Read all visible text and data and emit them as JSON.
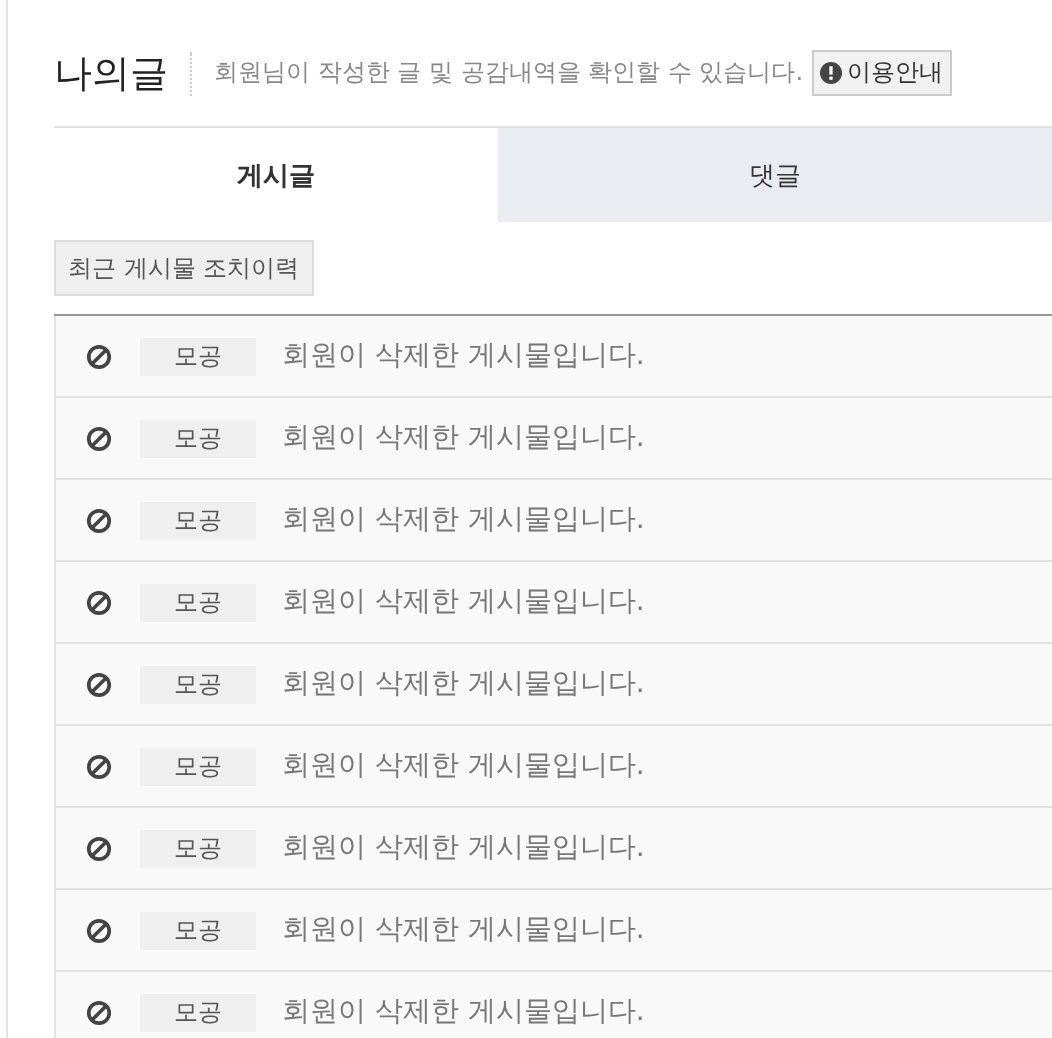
{
  "header": {
    "title": "나의글",
    "description": "회원님이 작성한 글 및 공감내역을 확인할 수 있습니다.",
    "guide_button": "이용안내"
  },
  "tabs": [
    {
      "label": "게시글",
      "selected": true
    },
    {
      "label": "댓글",
      "selected": false
    }
  ],
  "history_button": "최근 게시물 조치이력",
  "rows": [
    {
      "tag": "모공",
      "text": "회원이 삭제한 게시물입니다."
    },
    {
      "tag": "모공",
      "text": "회원이 삭제한 게시물입니다."
    },
    {
      "tag": "모공",
      "text": "회원이 삭제한 게시물입니다."
    },
    {
      "tag": "모공",
      "text": "회원이 삭제한 게시물입니다."
    },
    {
      "tag": "모공",
      "text": "회원이 삭제한 게시물입니다."
    },
    {
      "tag": "모공",
      "text": "회원이 삭제한 게시물입니다."
    },
    {
      "tag": "모공",
      "text": "회원이 삭제한 게시물입니다."
    },
    {
      "tag": "모공",
      "text": "회원이 삭제한 게시물입니다."
    },
    {
      "tag": "모공",
      "text": "회원이 삭제한 게시물입니다."
    }
  ]
}
